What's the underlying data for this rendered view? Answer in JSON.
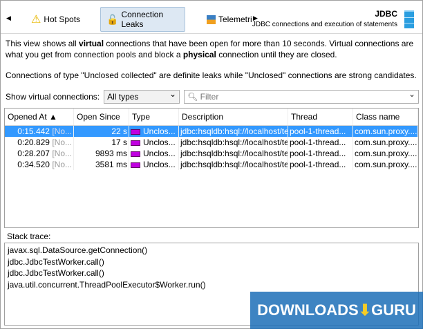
{
  "toolbar": {
    "tabs": [
      {
        "label": "Hot Spots",
        "icon": "warning-icon"
      },
      {
        "label": "Connection Leaks",
        "icon": "unlock-icon"
      },
      {
        "label": "Telemetri",
        "icon": "telemetry-icon"
      }
    ],
    "title": "JDBC",
    "subtitle": "JDBC connections and execution of statements"
  },
  "info": {
    "p1_a": "This view shows all ",
    "p1_b": "virtual",
    "p1_c": " connections that have been open for more than 10 seconds. Virtual connections are what you get from connection pools and block a ",
    "p1_d": "physical",
    "p1_e": " connection until they are closed.",
    "p2": "Connections of type \"Unclosed collected\" are definite leaks while \"Unclosed\" connections are strong candidates."
  },
  "filter": {
    "label": "Show virtual connections:",
    "selected": "All types",
    "placeholder": "Filter"
  },
  "table": {
    "headers": [
      "Opened At ▲",
      "Open Since",
      "Type",
      "Description",
      "Thread",
      "Class name"
    ],
    "rows": [
      {
        "opened": "0:15.442",
        "suffix": "[No...",
        "since": "22 s",
        "type": "Unclos...",
        "desc": "jdbc:hsqldb:hsql://localhost/test",
        "thread": "pool-1-thread...",
        "cls": "com.sun.proxy...."
      },
      {
        "opened": "0:20.829",
        "suffix": "[No...",
        "since": "17 s",
        "type": "Unclos...",
        "desc": "jdbc:hsqldb:hsql://localhost/test",
        "thread": "pool-1-thread...",
        "cls": "com.sun.proxy...."
      },
      {
        "opened": "0:28.207",
        "suffix": "[No...",
        "since": "9893 ms",
        "type": "Unclos...",
        "desc": "jdbc:hsqldb:hsql://localhost/test",
        "thread": "pool-1-thread...",
        "cls": "com.sun.proxy...."
      },
      {
        "opened": "0:34.520",
        "suffix": "[No...",
        "since": "3581 ms",
        "type": "Unclos...",
        "desc": "jdbc:hsqldb:hsql://localhost/test",
        "thread": "pool-1-thread...",
        "cls": "com.sun.proxy...."
      }
    ]
  },
  "stack": {
    "label": "Stack trace:",
    "lines": [
      "javax.sql.DataSource.getConnection()",
      "jdbc.JdbcTestWorker.call()",
      "jdbc.JdbcTestWorker.call()",
      "java.util.concurrent.ThreadPoolExecutor$Worker.run()"
    ]
  },
  "watermark": "DOWNLOADS.GURU"
}
